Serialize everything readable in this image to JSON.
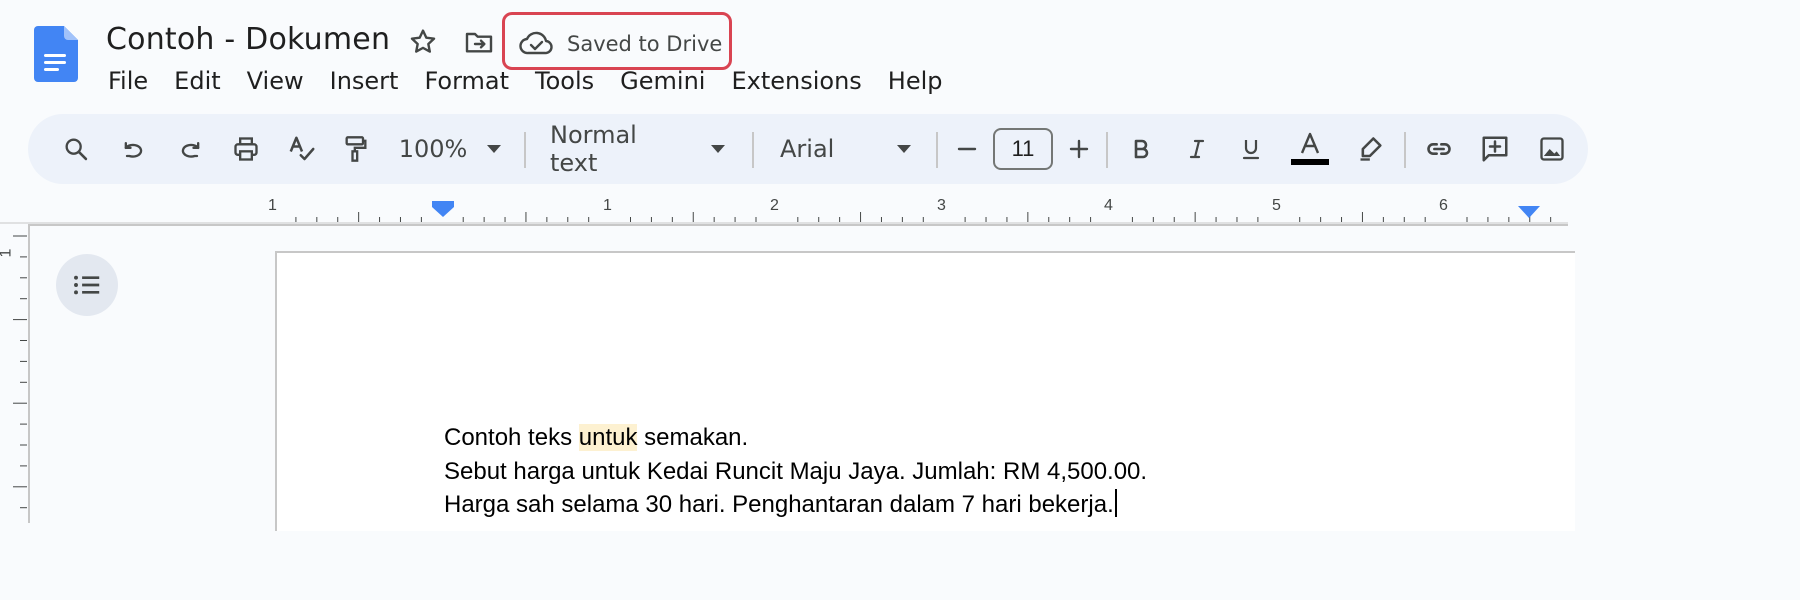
{
  "header": {
    "title": "Contoh - Dokumen",
    "save_status": "Saved to Drive",
    "icons": [
      "docs-logo-icon",
      "star-icon",
      "move-folder-icon",
      "cloud-check-icon"
    ]
  },
  "menu": [
    "File",
    "Edit",
    "View",
    "Insert",
    "Format",
    "Tools",
    "Gemini",
    "Extensions",
    "Help"
  ],
  "toolbar": {
    "zoom": "100%",
    "style": "Normal text",
    "font": "Arial",
    "font_size": "11",
    "text_color": "#000000",
    "icons": [
      "search-icon",
      "undo-icon",
      "redo-icon",
      "print-icon",
      "spellcheck-icon",
      "paint-format-icon",
      "zoom-dropdown-icon",
      "style-dropdown-icon",
      "font-dropdown-icon",
      "decrease-font-icon",
      "increase-font-icon",
      "bold-icon",
      "italic-icon",
      "underline-icon",
      "text-color-icon",
      "highlight-icon",
      "link-icon",
      "add-comment-icon",
      "image-icon"
    ]
  },
  "ruler": {
    "labels": [
      "1",
      "1",
      "2",
      "3",
      "4",
      "5",
      "6"
    ],
    "vertical_label": "1"
  },
  "document": {
    "line1_before": "Contoh teks ",
    "line1_highlight": "untuk",
    "line1_after": " semakan.",
    "line2": "Sebut harga untuk Kedai Runcit Maju Jaya. Jumlah: RM 4,500.00.",
    "line3": "Harga sah selama 30 hari. Penghantaran dalam 7 hari bekerja."
  },
  "colors": {
    "accent": "#4285f4",
    "badge_border": "#d94452",
    "toolbar_bg": "#edf2fa",
    "highlight": "#fdf1d1"
  }
}
